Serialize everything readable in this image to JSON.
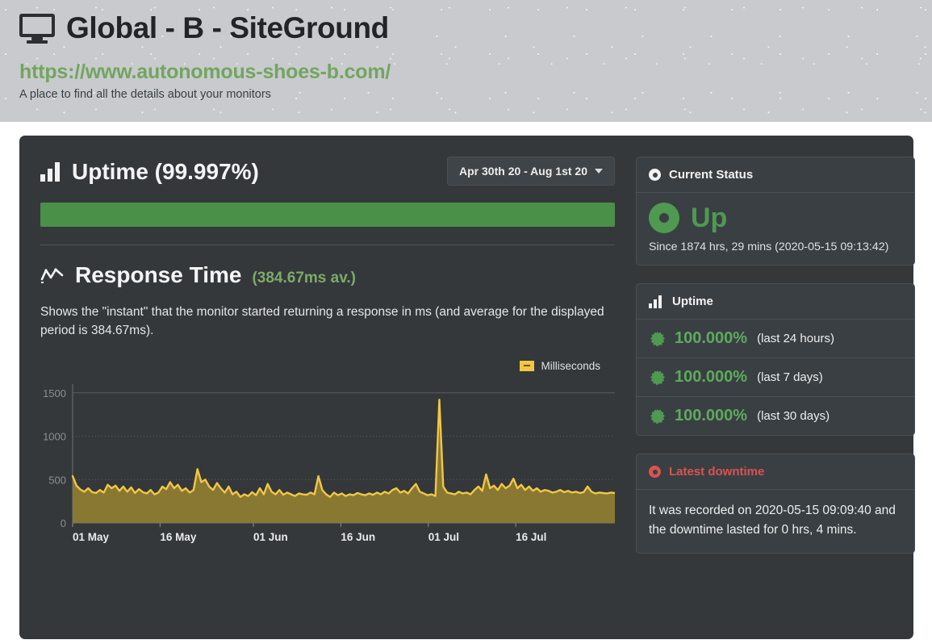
{
  "header": {
    "monitor_icon": "monitor-icon",
    "title": "Global - B - SiteGround",
    "url": "https://www.autonomous-shoes-b.com/",
    "subtitle": "A place to find all the details about your monitors"
  },
  "uptime_section": {
    "icon": "bar-chart-icon",
    "title": "Uptime (99.997%)",
    "date_range": "Apr 30th 20 - Aug 1st 20",
    "caret": "chevron-down-icon",
    "bar_color": "#4b9049",
    "bar_percent": "99.997%"
  },
  "response_section": {
    "icon": "line-chart-icon",
    "title": "Response Time",
    "average": "(384.67ms av.)",
    "description": "Shows the \"instant\" that the monitor started returning a response in ms (and average for the displayed period is 384.67ms)."
  },
  "legend": {
    "label": "Milliseconds",
    "color": "#f2c744"
  },
  "chart_data": {
    "type": "area",
    "title": "Response Time",
    "xlabel": "",
    "ylabel": "Milliseconds",
    "ylim": [
      0,
      1600
    ],
    "yticks": [
      0,
      500,
      1000,
      1500
    ],
    "grid": true,
    "legend_position": "top-right",
    "line_color": "#f2c744",
    "fill_color": "#8d7b32",
    "xtick_labels": [
      "01 May",
      "16 May",
      "01 Jun",
      "16 Jun",
      "01 Jul",
      "16 Jul"
    ],
    "xtick_positions": [
      0,
      15,
      31,
      46,
      61,
      76
    ],
    "x_range_days": [
      0,
      93
    ],
    "average": 384.67,
    "series": [
      {
        "name": "Milliseconds",
        "values": [
          540,
          430,
          385,
          360,
          400,
          355,
          345,
          380,
          350,
          440,
          400,
          430,
          370,
          420,
          360,
          410,
          345,
          390,
          355,
          340,
          380,
          330,
          350,
          420,
          390,
          470,
          400,
          440,
          370,
          400,
          350,
          380,
          620,
          470,
          500,
          420,
          380,
          460,
          400,
          350,
          420,
          330,
          360,
          300,
          330,
          310,
          355,
          320,
          400,
          330,
          450,
          360,
          330,
          380,
          325,
          350,
          330,
          310,
          340,
          330,
          325,
          350,
          330,
          540,
          380,
          330,
          300,
          350,
          320,
          340,
          310,
          330,
          320,
          345,
          330,
          320,
          340,
          325,
          350,
          330,
          360,
          340,
          380,
          400,
          350,
          370,
          340,
          400,
          450,
          360,
          340,
          320,
          330,
          310,
          1420,
          420,
          350,
          340,
          330,
          360,
          340,
          350,
          330,
          380,
          420,
          370,
          560,
          400,
          430,
          380,
          450,
          400,
          430,
          510,
          400,
          440,
          380,
          420,
          370,
          400,
          360,
          380,
          370,
          350,
          360,
          380,
          355,
          370,
          350,
          360,
          345,
          355,
          420,
          360,
          340,
          350,
          345,
          340,
          350,
          345
        ]
      }
    ]
  },
  "current_status": {
    "header_icon": "status-dot-icon",
    "header": "Current Status",
    "state_icon": "status-ring-icon",
    "state": "Up",
    "since": "Since 1874 hrs, 29 mins (2020-05-15 09:13:42)",
    "color": "#4e9a51"
  },
  "uptime_card": {
    "header_icon": "bar-chart-icon",
    "header": "Uptime",
    "rows": [
      {
        "icon": "starburst-icon",
        "value": "100.000%",
        "label": "(last 24 hours)"
      },
      {
        "icon": "starburst-icon",
        "value": "100.000%",
        "label": "(last 7 days)"
      },
      {
        "icon": "starburst-icon",
        "value": "100.000%",
        "label": "(last 30 days)"
      }
    ]
  },
  "latest_downtime": {
    "header_icon": "downtime-dot-icon",
    "header": "Latest downtime",
    "text": "It was recorded on 2020-05-15 09:09:40 and the downtime lasted for 0 hrs, 4 mins.",
    "color": "#d9534f"
  }
}
